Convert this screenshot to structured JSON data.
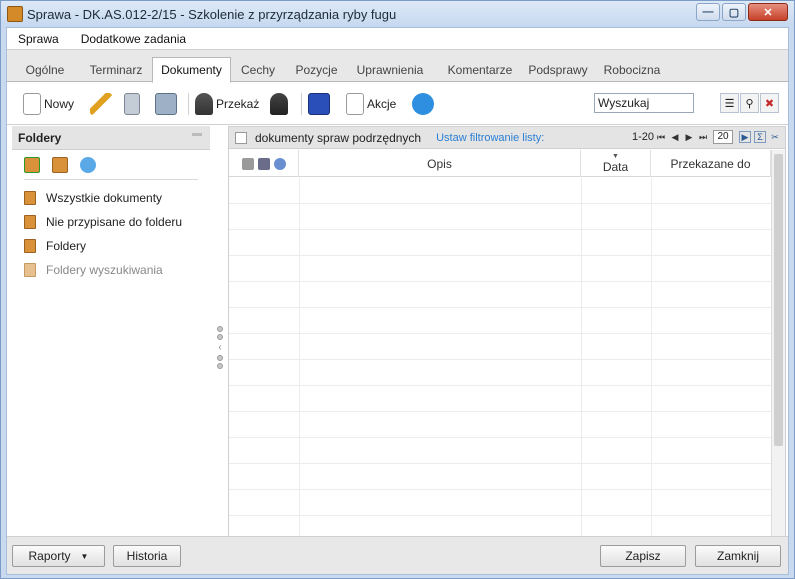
{
  "window": {
    "title": "Sprawa - DK.AS.012-2/15 - Szkolenie z przyrządzania ryby fugu",
    "minimize": "—",
    "maximize": "▢",
    "close": "✕"
  },
  "menu": [
    "Sprawa",
    "Dodatkowe zadania"
  ],
  "tabs": [
    "Ogólne",
    "Terminarz",
    "Dokumenty",
    "Cechy",
    "Pozycje",
    "Uprawnienia",
    "Komentarze",
    "Podsprawy",
    "Robocizna"
  ],
  "active_tab": "Dokumenty",
  "toolbar": {
    "new_label": "Nowy",
    "forward_label": "Przekaż",
    "actions_label": "Akcje"
  },
  "search": {
    "value": "Wyszukaj"
  },
  "folders": {
    "title": "Foldery",
    "items": [
      "Wszystkie dokumenty",
      "Nie przypisane do folderu",
      "Foldery",
      "Foldery wyszukiwania"
    ]
  },
  "docs": {
    "subdocs_label": "dokumenty spraw podrzędnych",
    "filter_link": "Ustaw filtrowanie listy:",
    "range": "1-20",
    "page_size": "20",
    "columns": {
      "description": "Opis",
      "date": "Data",
      "forwarded_to": "Przekazane do"
    }
  },
  "footer": {
    "reports": "Raporty",
    "history": "Historia",
    "save": "Zapisz",
    "close": "Zamknij"
  },
  "colors": {
    "accent": "#2a7fd4",
    "title_bg": "#c6d8ef",
    "close_button": "#c6412a"
  }
}
